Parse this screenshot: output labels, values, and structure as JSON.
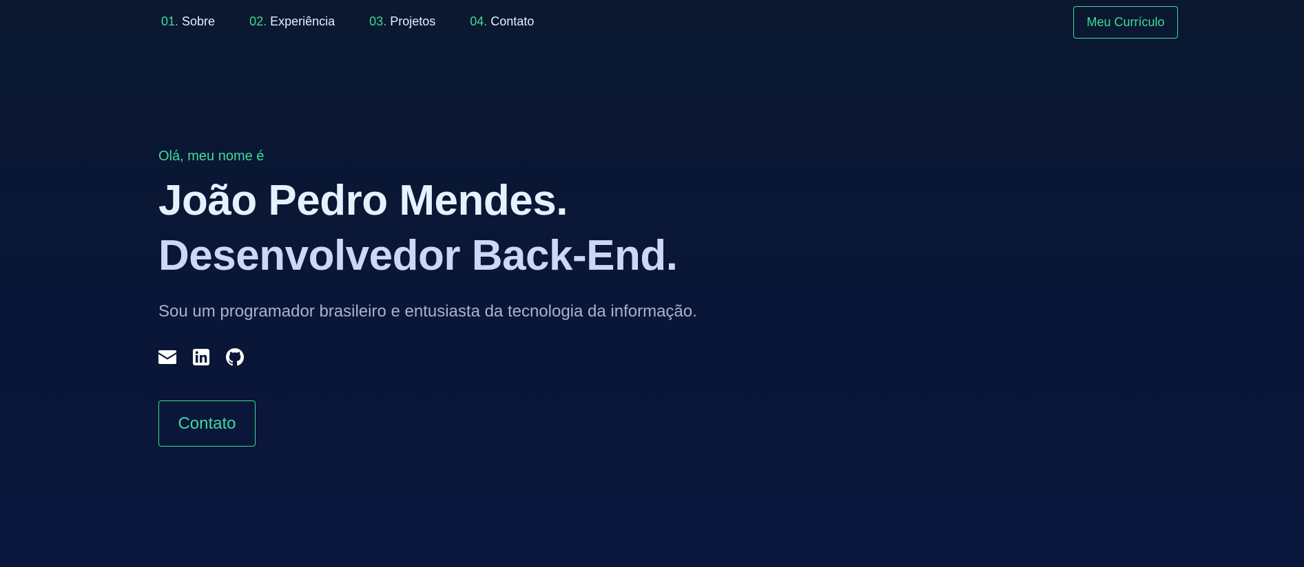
{
  "nav": {
    "items": [
      {
        "num": "01.",
        "label": "Sobre"
      },
      {
        "num": "02.",
        "label": "Experiência"
      },
      {
        "num": "03.",
        "label": "Projetos"
      },
      {
        "num": "04.",
        "label": "Contato"
      }
    ],
    "resume_label": "Meu Currículo"
  },
  "hero": {
    "greeting": "Olá, meu nome é",
    "name": "João Pedro Mendes.",
    "role": "Desenvolvedor Back-End.",
    "description": "Sou um programador brasileiro e entusiasta da tecnologia da informação.",
    "socials": [
      {
        "icon": "envelope-icon"
      },
      {
        "icon": "linkedin-icon"
      },
      {
        "icon": "github-icon"
      }
    ],
    "contact_label": "Contato"
  },
  "colors": {
    "background": "#0b1830",
    "accent": "#3ddc97",
    "heading": "#e6f1ff",
    "text": "#a8b2d1"
  }
}
